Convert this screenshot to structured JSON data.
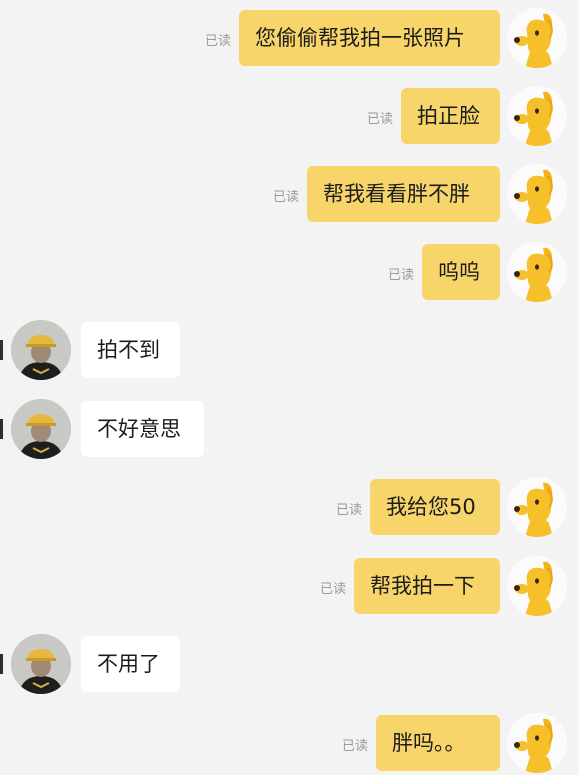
{
  "read_label": "已读",
  "colors": {
    "background": "#f3f3f3",
    "my_bubble": "#f7d56a",
    "their_bubble": "#ffffff",
    "read_text": "#9a9a9a"
  },
  "avatars": {
    "me": "yellow-cartoon-dog-avatar-icon",
    "them": "person-yellow-hard-hat-avatar-icon"
  },
  "messages": [
    {
      "side": "me",
      "text": "您偷偷帮我拍一张照片",
      "read": true
    },
    {
      "side": "me",
      "text": "拍正脸",
      "read": true
    },
    {
      "side": "me",
      "text": "帮我看看胖不胖",
      "read": true
    },
    {
      "side": "me",
      "text": "呜呜",
      "read": true
    },
    {
      "side": "them",
      "text": "拍不到"
    },
    {
      "side": "them",
      "text": "不好意思"
    },
    {
      "side": "me",
      "text": "我给您50",
      "read": true
    },
    {
      "side": "me",
      "text": "帮我拍一下",
      "read": true
    },
    {
      "side": "them",
      "text": "不用了"
    },
    {
      "side": "me",
      "text": "胖吗。。",
      "read": true
    }
  ]
}
